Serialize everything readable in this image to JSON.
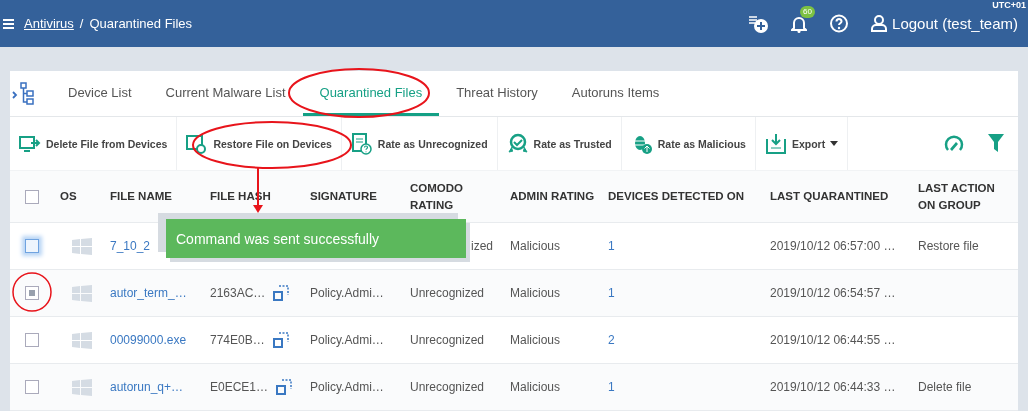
{
  "header": {
    "breadcrumb": [
      {
        "text": "Antivirus",
        "link": true
      },
      {
        "text": "/",
        "link": false
      },
      {
        "text": "Quarantined Files",
        "link": false
      }
    ],
    "notification_count": "60",
    "logout": "Logout (test_team)",
    "timezone": "UTC+01"
  },
  "tabs": [
    {
      "label": "Device List",
      "selected": false
    },
    {
      "label": "Current Malware List",
      "selected": false
    },
    {
      "label": "Quarantined Files",
      "selected": true
    },
    {
      "label": "Threat History",
      "selected": false
    },
    {
      "label": "Autoruns Items",
      "selected": false
    }
  ],
  "toolbar": [
    {
      "kind": "delete",
      "label": "Delete File from Devices"
    },
    {
      "kind": "restore",
      "label": "Restore File on Devices"
    },
    {
      "kind": "unrecognized",
      "label": "Rate as Unrecognized"
    },
    {
      "kind": "trusted",
      "label": "Rate as Trusted"
    },
    {
      "kind": "malicious",
      "label": "Rate as Malicious"
    },
    {
      "kind": "export",
      "label": "Export",
      "dropdown": true
    }
  ],
  "table": {
    "select_all": {
      "checked": false
    },
    "columns": [
      "OS",
      "FILE NAME",
      "FILE HASH",
      "SIGNATURE",
      "COMODO RATING",
      "ADMIN RATING",
      "DEVICES DETECTED ON",
      "LAST QUARANTINED",
      "LAST ACTION ON GROUP"
    ],
    "rows": [
      {
        "checked": false,
        "focused": true,
        "file_name": "7_10_2",
        "comodo_rating": "ized",
        "comodo_clipped": true,
        "admin_rating": "Malicious",
        "devices": "1",
        "last_quarantined": "2019/10/12 06:57:00 …",
        "last_action": "Restore file"
      },
      {
        "checked": true,
        "focused": false,
        "file_name": "autor_term_…",
        "file_hash": "2163AC…",
        "signature": "Policy.Admi…",
        "comodo_rating": "Unrecognized",
        "admin_rating": "Malicious",
        "devices": "1",
        "last_quarantined": "2019/10/12 06:54:57 …"
      },
      {
        "checked": false,
        "focused": false,
        "file_name": "00099000.exe",
        "file_hash": "774E0B…",
        "signature": "Policy.Admi…",
        "comodo_rating": "Unrecognized",
        "admin_rating": "Malicious",
        "devices": "2",
        "last_quarantined": "2019/10/12 06:44:55 …"
      },
      {
        "checked": false,
        "focused": false,
        "file_name": "autorun_q+…",
        "file_hash": "E0ECE1…",
        "signature": "Policy.Admi…",
        "comodo_rating": "Unrecognized",
        "admin_rating": "Malicious",
        "devices": "1",
        "last_quarantined": "2019/10/12 06:44:33 …",
        "last_action": "Delete file"
      }
    ]
  },
  "toast": "Command was sent successfully"
}
